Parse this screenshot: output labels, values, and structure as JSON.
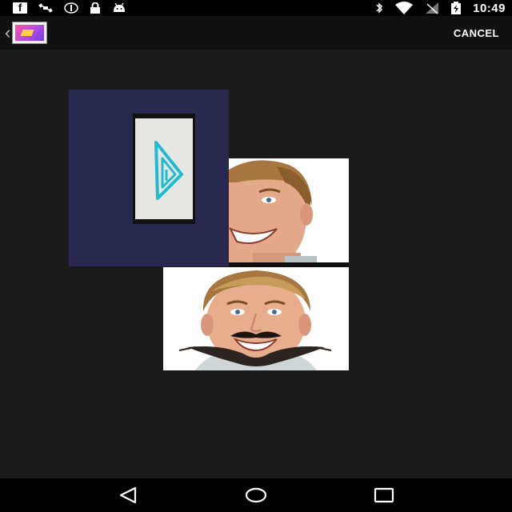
{
  "status_bar": {
    "time": "10:49",
    "left_icons": [
      "facebook-icon",
      "satellite-icon",
      "eye-icon",
      "lock-icon",
      "android-icon"
    ],
    "right_icons": [
      "bluetooth-icon",
      "wifi-icon",
      "signal-off-icon",
      "battery-charging-icon"
    ]
  },
  "action_bar": {
    "cancel_label": "CANCEL"
  },
  "media": {
    "items": [
      "video-thumbnail",
      "face-photo",
      "face-photo-mustache"
    ]
  },
  "nav_bar": {
    "buttons": [
      "back",
      "home",
      "recents"
    ]
  }
}
